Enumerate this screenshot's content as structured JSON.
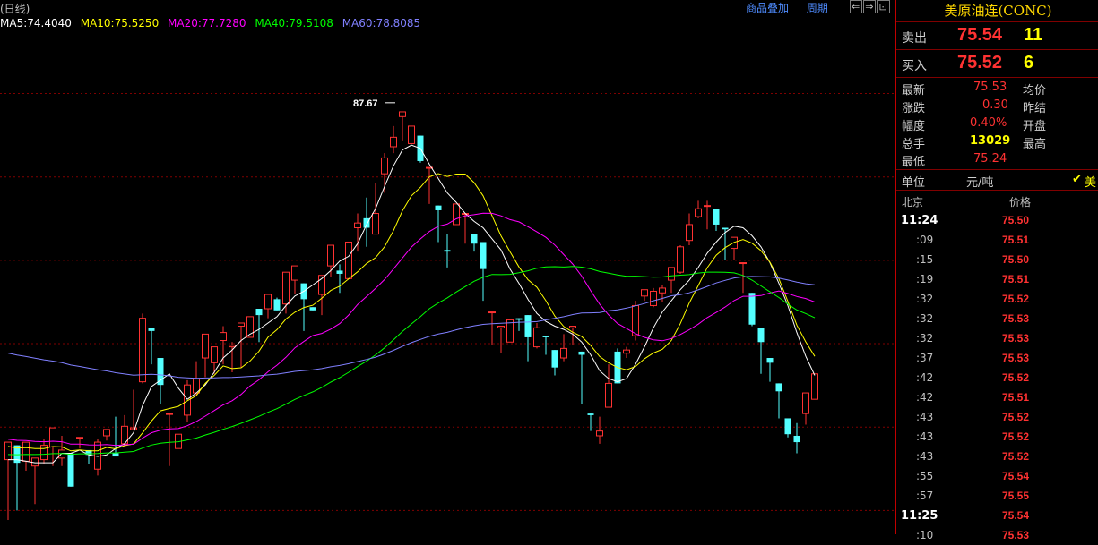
{
  "header": {
    "period": "(日线)",
    "links": [
      "商品叠加",
      "周期"
    ],
    "nav_icons": [
      "left-arrow-icon",
      "right-arrow-icon",
      "zoom-icon"
    ]
  },
  "ma_legend": [
    {
      "label": "MA5:74.4040",
      "color": "#ffffff"
    },
    {
      "label": "MA10:75.5250",
      "color": "#ffff00"
    },
    {
      "label": "MA20:77.7280",
      "color": "#ff00ff"
    },
    {
      "label": "MA40:79.5108",
      "color": "#00ff00"
    },
    {
      "label": "MA60:78.8085",
      "color": "#8080ff"
    }
  ],
  "colors": {
    "up": "#ff3232",
    "down": "#54ffff",
    "grid": "#800000",
    "ma5": "#ffffff",
    "ma10": "#ffff00",
    "ma20": "#ff00ff",
    "ma40": "#00ff00",
    "ma60": "#8080ff"
  },
  "chart_data": {
    "type": "candlestick",
    "ylim": [
      60.5,
      92
    ],
    "max_label": "87.67",
    "max_value": 87.67,
    "candles": [
      [
        65.2,
        66.3,
        64.1,
        61.4
      ],
      [
        66.1,
        65.0,
        61.7,
        62.0
      ],
      [
        65.1,
        66.3,
        65.0,
        64.5
      ],
      [
        64.8,
        65.3,
        64.8,
        62.4
      ],
      [
        65.2,
        66.1,
        66.5,
        64.9
      ],
      [
        66.0,
        67.2,
        66.4,
        64.8
      ],
      [
        65.3,
        65.8,
        66.7,
        64.8
      ],
      [
        65.6,
        63.5,
        65.0,
        64.1
      ],
      [
        66.6,
        66.6,
        64.2,
        65.9
      ],
      [
        65.8,
        65.5,
        65.0,
        64.9
      ],
      [
        64.6,
        66.3,
        66.5,
        64.2
      ],
      [
        66.7,
        67.1,
        65.2,
        66.4
      ],
      [
        65.6,
        65.4,
        67.9,
        65.5
      ],
      [
        66.2,
        67.3,
        68.0,
        66.2
      ],
      [
        67.1,
        67.2,
        69.6,
        67.1
      ],
      [
        70.1,
        74.1,
        74.4,
        70.0
      ],
      [
        73.5,
        73.3,
        72.2,
        71.2
      ],
      [
        71.6,
        69.9,
        69.8,
        68.7
      ],
      [
        68.1,
        68.1,
        66.6,
        64.8
      ],
      [
        65.9,
        66.8,
        66.5,
        66.5
      ],
      [
        68.0,
        69.9,
        70.2,
        67.6
      ],
      [
        69.4,
        70.3,
        71.4,
        69.2
      ],
      [
        71.6,
        73.1,
        71.7,
        70.4
      ],
      [
        71.3,
        72.3,
        71.7,
        70.6
      ],
      [
        72.7,
        73.2,
        73.6,
        71.2
      ],
      [
        72.3,
        72.4,
        72.6,
        70.7
      ],
      [
        73.6,
        73.8,
        73.0,
        71.0
      ],
      [
        72.9,
        74.2,
        73.6,
        73.2
      ],
      [
        74.7,
        74.3,
        74.4,
        72.6
      ],
      [
        74.7,
        75.6,
        74.9,
        74.1
      ],
      [
        75.3,
        74.6,
        75.4,
        74.6
      ],
      [
        75.0,
        77.0,
        76.5,
        74.4
      ],
      [
        76.5,
        77.4,
        76.6,
        75.6
      ],
      [
        76.3,
        75.3,
        75.6,
        73.3
      ],
      [
        74.8,
        74.6,
        74.8,
        74.7
      ],
      [
        75.6,
        76.8,
        76.8,
        74.3
      ],
      [
        77.4,
        78.7,
        77.3,
        76.7
      ],
      [
        77.1,
        76.9,
        77.5,
        75.7
      ],
      [
        76.6,
        78.9,
        78.5,
        76.6
      ],
      [
        79.8,
        80.1,
        80.7,
        78.3
      ],
      [
        80.4,
        79.8,
        81.7,
        78.6
      ],
      [
        79.4,
        80.7,
        82.6,
        79.6
      ],
      [
        83.2,
        84.2,
        84.5,
        82.0
      ],
      [
        84.9,
        85.5,
        86.2,
        84.5
      ],
      [
        86.8,
        87.1,
        86.1,
        85.3
      ],
      [
        85.1,
        86.2,
        84.7,
        85.2
      ],
      [
        85.6,
        84.0,
        85.2,
        83.9
      ],
      [
        83.6,
        83.6,
        82.3,
        81.3
      ],
      [
        81.2,
        80.9,
        79.1,
        78.9
      ],
      [
        78.4,
        78.3,
        79.4,
        77.3
      ],
      [
        80.0,
        81.3,
        80.5,
        80.0
      ],
      [
        80.7,
        80.7,
        80.6,
        78.8
      ],
      [
        79.4,
        78.8,
        78.5,
        78.3
      ],
      [
        78.9,
        77.2,
        75.9,
        75.2
      ],
      [
        74.5,
        74.5,
        74.1,
        72.4
      ],
      [
        73.5,
        73.6,
        73.2,
        71.9
      ],
      [
        72.6,
        74.0,
        73.7,
        72.7
      ],
      [
        74.1,
        74.0,
        73.7,
        73.3
      ],
      [
        74.3,
        72.9,
        73.4,
        71.4
      ],
      [
        72.3,
        73.5,
        73.8,
        72.2
      ],
      [
        73.0,
        72.9,
        72.1,
        71.8
      ],
      [
        72.1,
        71.0,
        71.6,
        70.5
      ],
      [
        71.6,
        72.2,
        73.1,
        71.4
      ],
      [
        73.5,
        73.6,
        72.9,
        72.4
      ],
      [
        72.0,
        71.8,
        70.1,
        68.7
      ],
      [
        68.1,
        68.0,
        67.1,
        67.0
      ],
      [
        66.7,
        67.0,
        67.9,
        66.2
      ],
      [
        68.5,
        70.0,
        71.2,
        68.5
      ],
      [
        72.0,
        70.0,
        72.2,
        70.6
      ],
      [
        71.9,
        72.1,
        72.3,
        71.6
      ],
      [
        73.0,
        74.9,
        75.2,
        72.7
      ],
      [
        75.5,
        75.9,
        74.9,
        75.2
      ],
      [
        74.9,
        75.8,
        76.0,
        74.8
      ],
      [
        75.7,
        76.0,
        76.2,
        75.1
      ],
      [
        76.5,
        77.3,
        76.4,
        75.7
      ],
      [
        77.0,
        78.6,
        78.7,
        76.9
      ],
      [
        79.0,
        80.0,
        80.7,
        78.7
      ],
      [
        80.5,
        81.0,
        81.5,
        80.4
      ],
      [
        81.2,
        81.2,
        81.5,
        79.7
      ],
      [
        81.0,
        80.0,
        79.7,
        79.6
      ],
      [
        79.8,
        79.7,
        79.3,
        77.8
      ],
      [
        78.5,
        79.2,
        78.0,
        77.8
      ],
      [
        77.6,
        77.6,
        76.2,
        75.7
      ],
      [
        75.7,
        73.7,
        73.5,
        73.6
      ],
      [
        73.5,
        72.6,
        72.6,
        70.6
      ],
      [
        71.6,
        71.3,
        71.2,
        70.1
      ],
      [
        70.0,
        69.5,
        68.3,
        67.8
      ],
      [
        67.8,
        66.8,
        66.4,
        66.6
      ],
      [
        66.7,
        66.3,
        67.5,
        65.6
      ],
      [
        68.1,
        69.4,
        69.2,
        67.4
      ],
      [
        69.0,
        70.6,
        70.3,
        69.6
      ]
    ],
    "ma5": [
      65.2,
      65.2,
      65.1,
      65.0,
      65.0,
      65.0,
      65.6,
      65.6,
      65.8,
      65.5,
      65.4,
      65.5,
      65.9,
      66.2,
      66.9,
      68.6,
      69.8,
      70.2,
      70.6,
      69.7,
      69.0,
      69.4,
      69.9,
      70.7,
      71.6,
      72.1,
      72.7,
      73.1,
      73.4,
      73.8,
      74.2,
      74.9,
      75.5,
      75.8,
      76.2,
      76.6,
      77.1,
      77.7,
      78.0,
      78.8,
      80.0,
      81.0,
      82.4,
      83.7,
      84.7,
      85.0,
      84.8,
      83.8,
      82.9,
      82.0,
      81.4,
      80.7,
      80.2,
      79.8,
      79.1,
      78.4,
      77.2,
      76.3,
      75.3,
      74.4,
      73.9,
      73.6,
      73.4,
      73.1,
      72.6,
      71.8,
      70.8,
      70.3,
      70.1,
      70.3,
      71.2,
      72.3,
      73.5,
      74.5,
      75.2,
      75.9,
      76.5,
      77.3,
      78.2,
      78.9,
      79.5,
      79.9,
      79.8,
      79.3,
      78.6,
      77.6,
      76.3,
      74.9,
      73.2,
      71.7,
      70.5
    ]
  },
  "side": {
    "title": "美原油连(CONC)",
    "ask": {
      "label": "卖出",
      "price": "75.54",
      "vol": "11"
    },
    "bid": {
      "label": "买入",
      "price": "75.52",
      "vol": "6"
    },
    "stats": [
      {
        "label": "最新",
        "value": "75.53"
      },
      {
        "label": "均价",
        "value": ""
      },
      {
        "label": "涨跌",
        "value": "0.30"
      },
      {
        "label": "昨结",
        "value": ""
      },
      {
        "label": "幅度",
        "value": "0.40%"
      },
      {
        "label": "开盘",
        "value": ""
      },
      {
        "label": "总手",
        "value": "13029"
      },
      {
        "label": "最高",
        "value": ""
      },
      {
        "label": "最低",
        "value": "75.24"
      }
    ],
    "unit_label": "单位",
    "unit_value": "元/吨",
    "unit_check": "美",
    "ticks_header": {
      "time": "北京",
      "price": "价格"
    },
    "ticks": [
      {
        "time": "11:24",
        "price": "75.50"
      },
      {
        "time": ":09",
        "price": "75.51"
      },
      {
        "time": ":15",
        "price": "75.50"
      },
      {
        "time": ":19",
        "price": "75.51"
      },
      {
        "time": ":32",
        "price": "75.52"
      },
      {
        "time": ":32",
        "price": "75.53"
      },
      {
        "time": ":32",
        "price": "75.53"
      },
      {
        "time": ":37",
        "price": "75.53"
      },
      {
        "time": ":42",
        "price": "75.52"
      },
      {
        "time": ":42",
        "price": "75.51"
      },
      {
        "time": ":43",
        "price": "75.52"
      },
      {
        "time": ":43",
        "price": "75.52"
      },
      {
        "time": ":43",
        "price": "75.52"
      },
      {
        "time": ":55",
        "price": "75.54"
      },
      {
        "time": ":57",
        "price": "75.55"
      },
      {
        "time": "11:25",
        "price": "75.54"
      },
      {
        "time": ":10",
        "price": "75.53"
      }
    ]
  }
}
